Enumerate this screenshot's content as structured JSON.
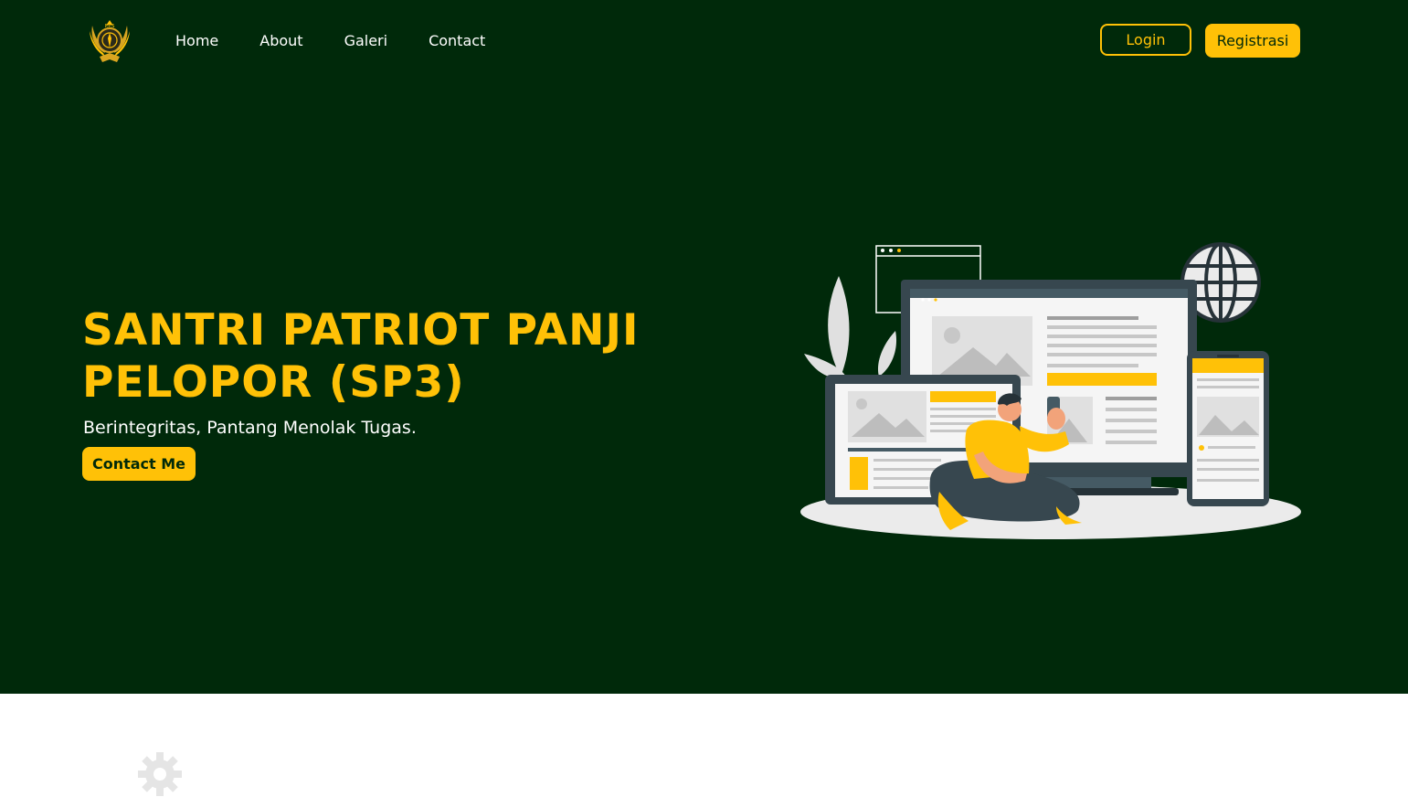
{
  "nav": {
    "links": [
      "Home",
      "About",
      "Galeri",
      "Contact"
    ],
    "login_label": "Login",
    "register_label": "Registrasi"
  },
  "hero": {
    "title": "SANTRI PATRIOT PANJI PELOPOR (SP3)",
    "subtitle": "Berintegritas, Pantang Menolak Tugas.",
    "cta_label": "Contact Me"
  },
  "colors": {
    "background": "#00290a",
    "accent": "#ffc107",
    "text": "#ffffff"
  },
  "icons": [
    "sp3-logo",
    "gear-icon"
  ]
}
